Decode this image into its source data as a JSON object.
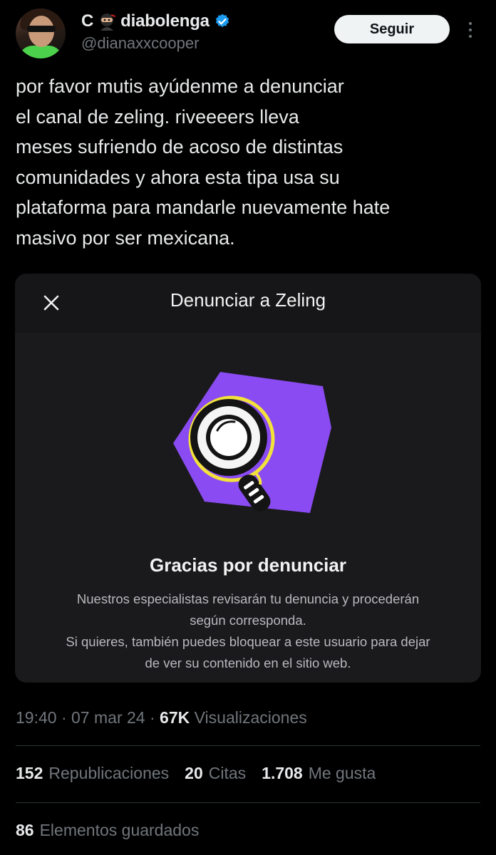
{
  "tweet": {
    "display_name": "C",
    "display_name_suffix": "diabolenga",
    "handle": "@dianaxxcooper",
    "follow_label": "Seguir",
    "text": "por favor mutis ayúdenme a denunciar\nel canal de zeling. riveeeers lleva\nmeses sufriendo de acoso de distintas\ncomunidades y ahora esta tipa usa su\nplataforma para mandarle nuevamente hate\nmasivo por ser mexicana.",
    "icons": [
      "ninja-emoji",
      "verified-badge-icon",
      "more-options-icon"
    ]
  },
  "embedded_card": {
    "title": "Denunciar a Zeling",
    "close_icon": "close-icon",
    "thanks_heading": "Gracias por denunciar",
    "description": "Nuestros especialistas revisarán tu denuncia y procederán\nsegún corresponda.\nSi quieres, también puedes bloquear a este usuario para dejar\nde ver su contenido en el sitio web.",
    "colors": {
      "purple": "#8a4bf2",
      "yellow": "#f2e23a"
    }
  },
  "meta": {
    "time": "19:40",
    "date": "07 mar 24",
    "views_count": "67K",
    "views_label": "Visualizaciones"
  },
  "stats": [
    {
      "count": "152",
      "label": "Republicaciones"
    },
    {
      "count": "20",
      "label": "Citas"
    },
    {
      "count": "1.708",
      "label": "Me gusta"
    }
  ],
  "saved": {
    "count": "86",
    "label": "Elementos guardados"
  },
  "colors": {
    "background": "#000000",
    "verified": "#1d9bf0",
    "text_secondary": "#71767b"
  }
}
